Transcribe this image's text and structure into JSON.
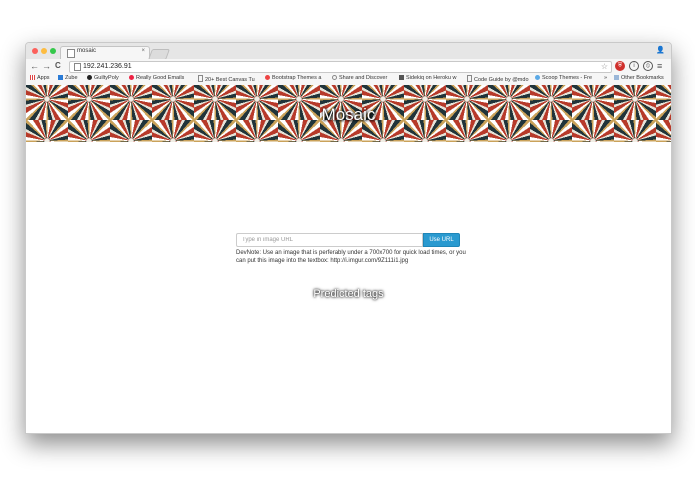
{
  "browser": {
    "tab_title": "mosaic",
    "tab_close": "×",
    "url": "192.241.236.91",
    "nav": {
      "back": "←",
      "forward": "→",
      "reload": "C"
    },
    "star": "☆",
    "extensions": [
      {
        "name": "shield-icon",
        "glyph": "",
        "color": "#d0312d"
      },
      {
        "name": "info-icon",
        "glyph": "i",
        "color": "#555555"
      },
      {
        "name": "blocked-icon",
        "glyph": "",
        "color": "#555555"
      }
    ],
    "menu": "≡",
    "user": "👤"
  },
  "bookmarks": [
    "Apps",
    "Zube",
    "GuiltyPoly",
    "Really Good Emails",
    "20+ Best Canvas Tu",
    "Bootstrap Themes a",
    "Share and Discover",
    "Sidekiq on Heroku w",
    "Code Guide by @mdo",
    "Scoop Themes - Fre",
    "»",
    "Other Bookmarks"
  ],
  "page": {
    "banner_title": "Mosaic",
    "input_placeholder": "Type in image URL",
    "use_url_button": "Use URL",
    "devnote": "DevNote: Use an image that is perferably under a 700x700 for quick load times, or you can put this image into the textbox: http://i.imgur.com/9Z111i1.jpg",
    "predicted_tags_heading": "Predicted tags"
  }
}
